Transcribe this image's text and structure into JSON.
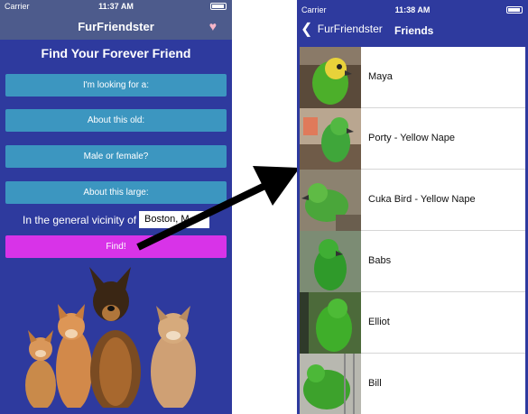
{
  "left_screen": {
    "status": {
      "carrier": "Carrier",
      "time": "11:37 AM"
    },
    "nav": {
      "title": "FurFriendster",
      "heart_icon": "heart-icon",
      "heart_color": "#f7b6c9"
    },
    "headline": "Find Your Forever Friend",
    "filters": [
      {
        "label": "I'm looking for a:"
      },
      {
        "label": "About this old:"
      },
      {
        "label": "Male or female?"
      },
      {
        "label": "About this large:"
      }
    ],
    "vicinity": {
      "label": "In the general vicinity of",
      "value": "Boston, M"
    },
    "find_label": "Find!",
    "colors": {
      "background": "#2e3a9e",
      "nav": "#4d5b8c",
      "pill": "#3c96c0",
      "find": "#d833e8"
    }
  },
  "right_screen": {
    "status": {
      "carrier": "Carrier",
      "time": "11:38 AM"
    },
    "nav": {
      "back_label": "FurFriendster",
      "back_icon": "chevron-left-icon",
      "title": "Friends"
    },
    "friends": [
      {
        "name": "Maya"
      },
      {
        "name": "Porty - Yellow Nape"
      },
      {
        "name": "Cuka Bird - Yellow Nape"
      },
      {
        "name": "Babs"
      },
      {
        "name": "Elliot"
      },
      {
        "name": "Bill"
      }
    ]
  }
}
